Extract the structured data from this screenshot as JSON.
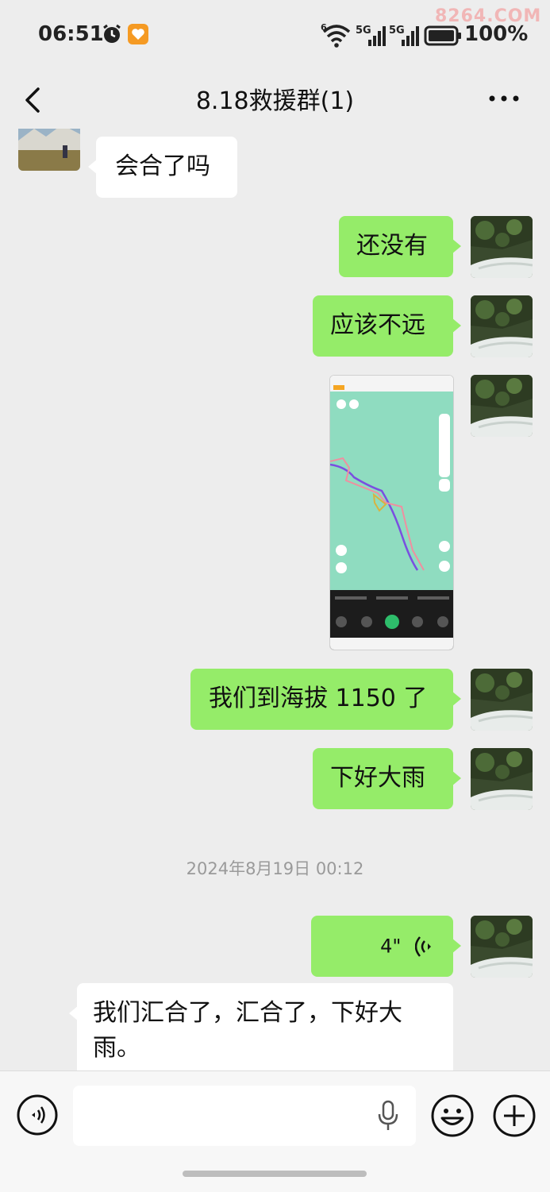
{
  "status_bar": {
    "time": "06:51",
    "network_1": "5G",
    "network_2": "5G",
    "battery": "100%",
    "watermark": "8264.COM"
  },
  "header": {
    "title": "8.18救援群(1)"
  },
  "messages": [
    {
      "side": "other",
      "type": "text",
      "text": "会合了吗"
    },
    {
      "side": "me",
      "type": "text",
      "text": "还没有"
    },
    {
      "side": "me",
      "type": "text",
      "text": "应该不远"
    },
    {
      "side": "me",
      "type": "image",
      "alt": "map-track-screenshot"
    },
    {
      "side": "me",
      "type": "text",
      "text": "我们到海拔 1150 了"
    },
    {
      "side": "me",
      "type": "text",
      "text": "下好大雨"
    },
    {
      "type": "timestamp",
      "text": "2024年8月19日 00:12"
    },
    {
      "side": "me",
      "type": "voice",
      "duration": "4\""
    },
    {
      "side": "other",
      "type": "text",
      "text": "我们汇合了，汇合了，下好大雨。"
    }
  ],
  "input_bar": {
    "placeholder": ""
  },
  "colors": {
    "my_bubble": "#95ec69",
    "other_bubble": "#ffffff",
    "background": "#ededed",
    "watermark": "#f1b6b6"
  }
}
